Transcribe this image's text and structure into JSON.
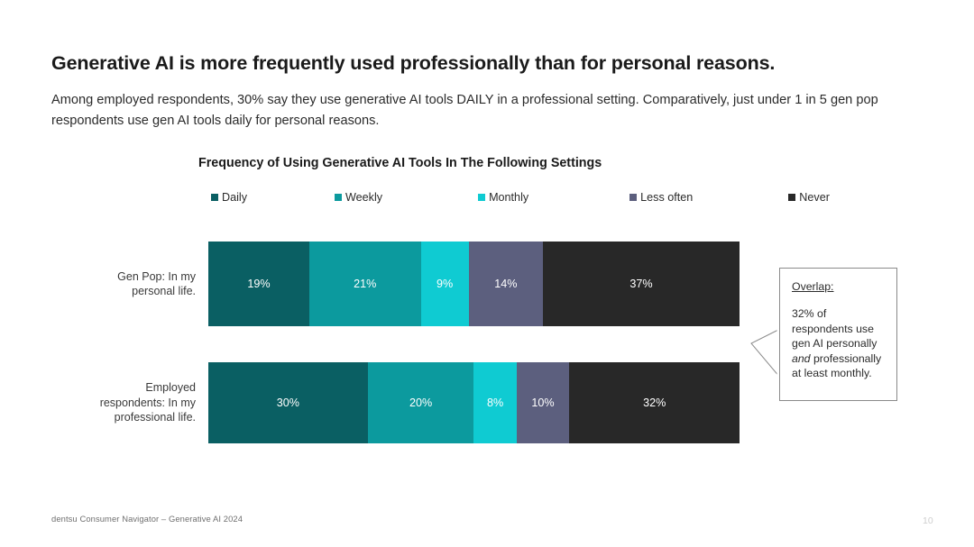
{
  "slide": {
    "headline": "Generative AI is more frequently used professionally than for personal reasons.",
    "subhead": "Among employed respondents, 30% say they use generative AI tools DAILY in a professional setting. Comparatively, just under 1 in 5 gen pop respondents use gen AI tools daily for personal reasons.",
    "footer_note": "dentsu Consumer Navigator –  Generative AI 2024",
    "page_number": "10"
  },
  "callout": {
    "title": "Overlap:",
    "body_part1": "32% of respondents use gen AI personally ",
    "body_italic": "and",
    "body_part2": " professionally at least monthly."
  },
  "chart_data": {
    "type": "bar",
    "orientation": "horizontal",
    "stacked": true,
    "stacked_percent": true,
    "title": "Frequency of Using Generative AI Tools In The Following Settings",
    "xlabel": "",
    "ylabel": "",
    "grid": false,
    "legend_position": "top-left",
    "xlim": [
      0,
      100
    ],
    "categories": [
      "Gen Pop: In my personal life.",
      "Employed respondents: In my professional life."
    ],
    "series": [
      {
        "name": "Daily",
        "color": "#0A5F63",
        "values": [
          19,
          30
        ],
        "labels": [
          "19%",
          "30%"
        ]
      },
      {
        "name": "Weekly",
        "color": "#0C9A9E",
        "values": [
          21,
          20
        ],
        "labels": [
          "21%",
          "20%"
        ]
      },
      {
        "name": "Monthly",
        "color": "#0FCBD2",
        "values": [
          9,
          8
        ],
        "labels": [
          "9%",
          "8%"
        ]
      },
      {
        "name": "Less often",
        "color": "#5C5F7E",
        "values": [
          14,
          10
        ],
        "labels": [
          "14%",
          "10%"
        ]
      },
      {
        "name": "Never",
        "color": "#282828",
        "values": [
          37,
          32
        ],
        "labels": [
          "37%",
          "32%"
        ]
      }
    ]
  }
}
